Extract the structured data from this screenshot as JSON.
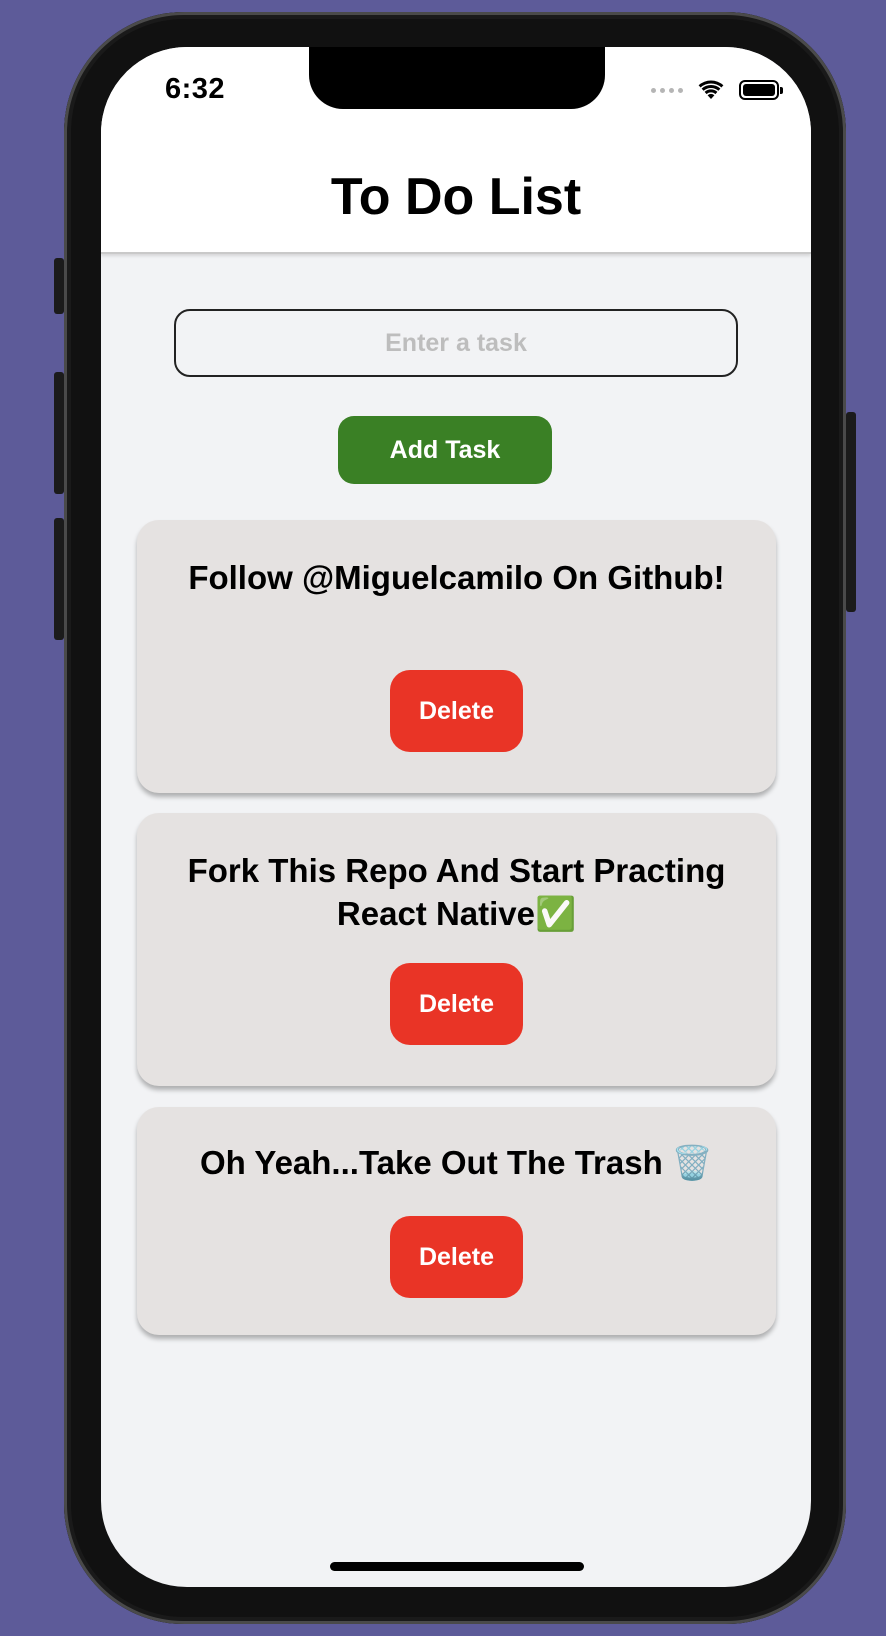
{
  "status_bar": {
    "time": "6:32"
  },
  "header": {
    "title": "To Do List"
  },
  "task_input": {
    "value": "",
    "placeholder": "Enter a task"
  },
  "add_button": {
    "label": "Add Task"
  },
  "tasks": [
    {
      "text": "Follow @Miguelcamilo On Github!",
      "delete_label": "Delete"
    },
    {
      "text": "Fork This Repo And Start Practing React Native✅",
      "delete_label": "Delete"
    },
    {
      "text": "Oh Yeah...Take Out The Trash 🗑️",
      "delete_label": "Delete"
    }
  ],
  "colors": {
    "add_button": "#3a8025",
    "delete_button": "#e93426",
    "card_background": "#e5e2e1",
    "screen_background": "#f2f3f5",
    "page_background": "#5d5b99"
  },
  "icons": {
    "signal": "cellular-signal-icon",
    "wifi": "wifi-icon",
    "battery": "battery-icon"
  }
}
